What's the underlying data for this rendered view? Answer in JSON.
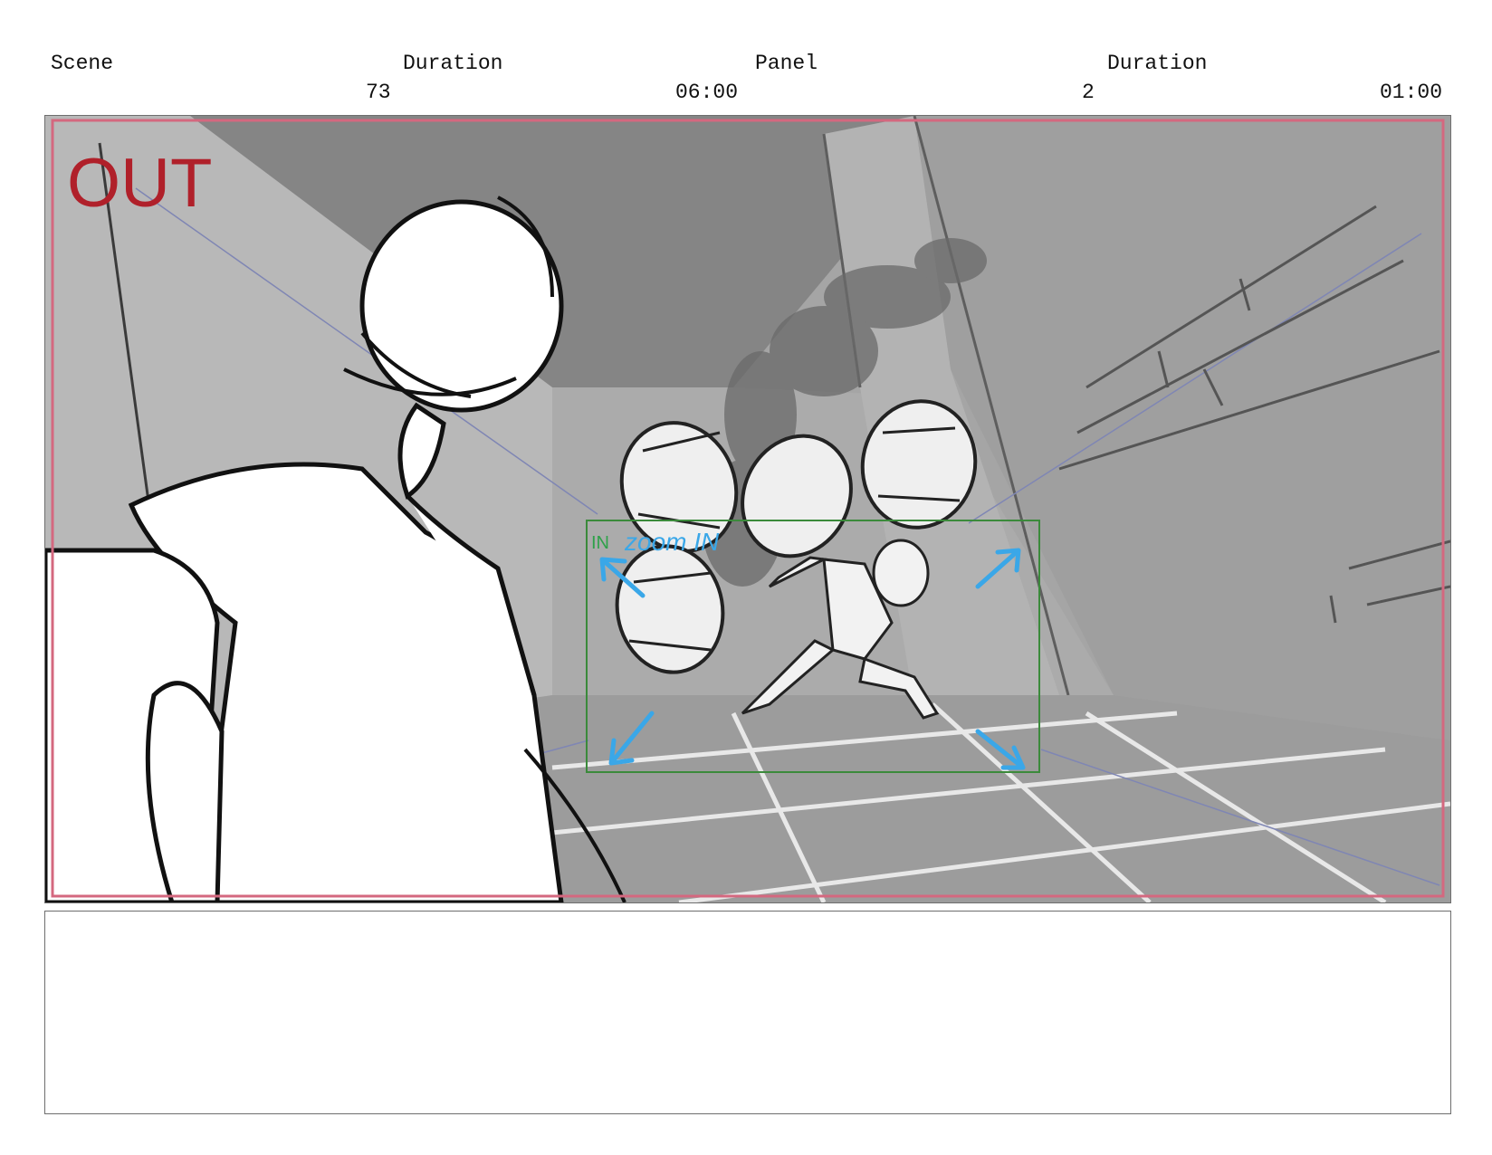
{
  "header": {
    "scene_label": "Scene",
    "scene_duration_label": "Duration",
    "panel_label": "Panel",
    "panel_duration_label": "Duration",
    "scene_number": "73",
    "scene_duration": "06:00",
    "panel_number": "2",
    "panel_duration": "01:00"
  },
  "panel": {
    "out_label": "OUT",
    "in_label": "IN",
    "camera_note": "zoom IN",
    "colors": {
      "safe_frame": "#d4687f",
      "out_text": "#b0202a",
      "in_frame": "#3b8a3b",
      "camera_arrows": "#3aa7e8",
      "in_text": "#2fa14a"
    }
  },
  "notes": {
    "text": ""
  }
}
